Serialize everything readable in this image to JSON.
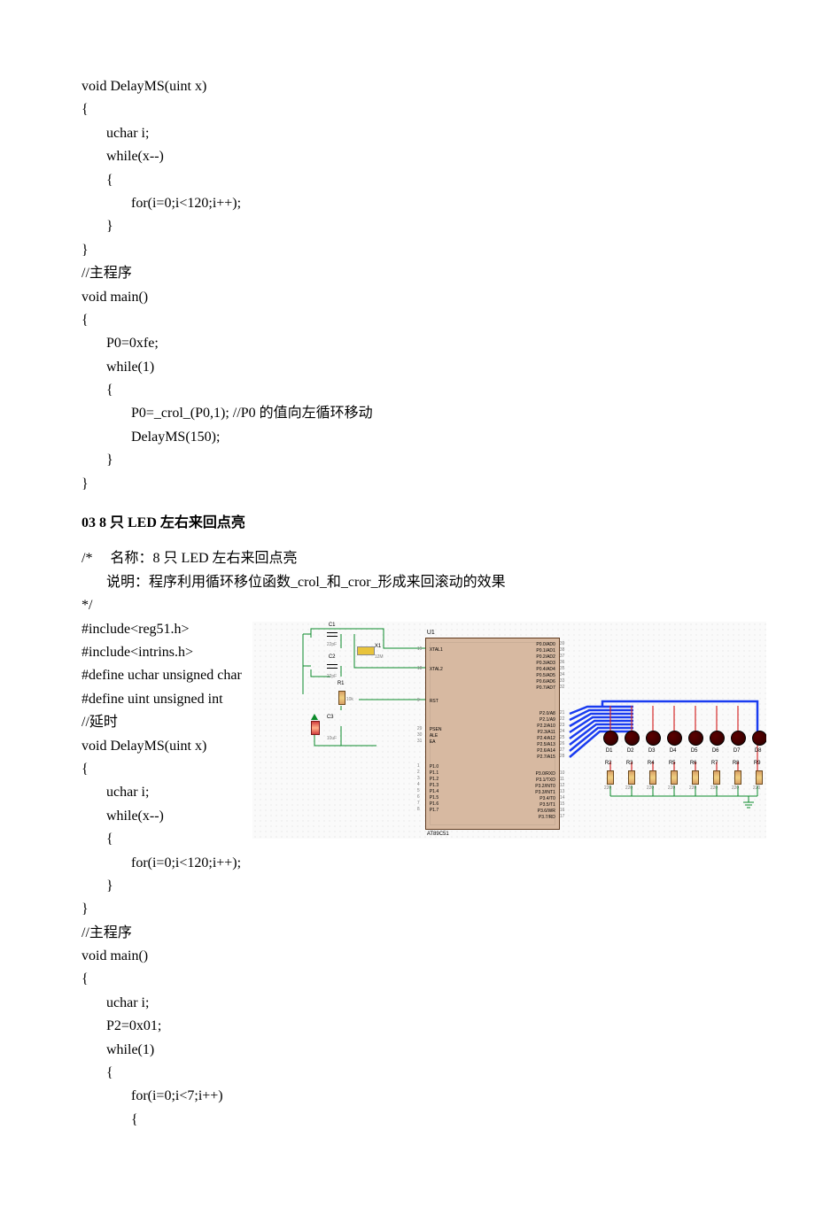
{
  "code1": "void DelayMS(uint x)\n{\n       uchar i;\n       while(x--)\n       {\n              for(i=0;i<120;i++);\n       }\n}\n//主程序\nvoid main()\n{\n       P0=0xfe;\n       while(1)\n       {\n              P0=_crol_(P0,1); //P0 的值向左循环移动\n              DelayMS(150);\n       }\n}",
  "heading": "03   8 只 LED 左右来回点亮",
  "comment": "/*     名称：8 只 LED 左右来回点亮\n       说明：程序利用循环移位函数_crol_和_cror_形成来回滚动的效果\n*/",
  "code2a": "#include<reg51.h>\n#include<intrins.h>\n#define uchar unsigned char\n#define uint unsigned int\n//延时\nvoid DelayMS(uint x)\n{\n       uchar i;\n       while(x--)\n       {\n              for(i=0;i<120;i++);\n       }\n}",
  "code2b": "//主程序\nvoid main()\n{\n       uchar i;\n       P2=0x01;\n       while(1)\n       {\n              for(i=0;i<7;i++)\n              {",
  "schematic": {
    "u1": "U1",
    "chip": "AT89C51",
    "left_pins": [
      "XTAL1",
      "XTAL2",
      "RST",
      "PSEN",
      "ALE",
      "EA",
      "P1.0",
      "P1.1",
      "P1.2",
      "P1.3",
      "P1.4",
      "P1.5",
      "P1.6",
      "P1.7"
    ],
    "left_nums": [
      "19",
      "18",
      "9",
      "29",
      "30",
      "31",
      "1",
      "2",
      "3",
      "4",
      "5",
      "6",
      "7",
      "8"
    ],
    "right_pins_top": [
      "P0.0/AD0",
      "P0.1/AD1",
      "P0.2/AD2",
      "P0.3/AD3",
      "P0.4/AD4",
      "P0.5/AD5",
      "P0.6/AD6",
      "P0.7/AD7"
    ],
    "right_nums_top": [
      "39",
      "38",
      "37",
      "36",
      "35",
      "34",
      "33",
      "32"
    ],
    "right_pins_mid": [
      "P2.0/A8",
      "P2.1/A9",
      "P2.2/A10",
      "P2.3/A11",
      "P2.4/A12",
      "P2.5/A13",
      "P2.6/A14",
      "P2.7/A15"
    ],
    "right_nums_mid": [
      "21",
      "22",
      "23",
      "24",
      "25",
      "26",
      "27",
      "28"
    ],
    "right_pins_bot": [
      "P3.0/RXD",
      "P3.1/TXD",
      "P3.2/INT0",
      "P3.3/INT1",
      "P3.4/T0",
      "P3.5/T1",
      "P3.6/WR",
      "P3.7/RD"
    ],
    "right_nums_bot": [
      "10",
      "11",
      "12",
      "13",
      "14",
      "15",
      "16",
      "17"
    ],
    "c1": "C1",
    "c1v": "22pF",
    "c2": "C2",
    "c2v": "22pF",
    "x1": "X1",
    "x1v": "12M",
    "r1": "R1",
    "r1v": "10k",
    "c3": "C3",
    "c3v": "10uF",
    "leds": [
      "D1",
      "D2",
      "D3",
      "D4",
      "D5",
      "D6",
      "D7",
      "D8"
    ],
    "res_r": [
      "R2",
      "R3",
      "R4",
      "R5",
      "R6",
      "R7",
      "R8",
      "R9"
    ],
    "res_v": "220"
  }
}
